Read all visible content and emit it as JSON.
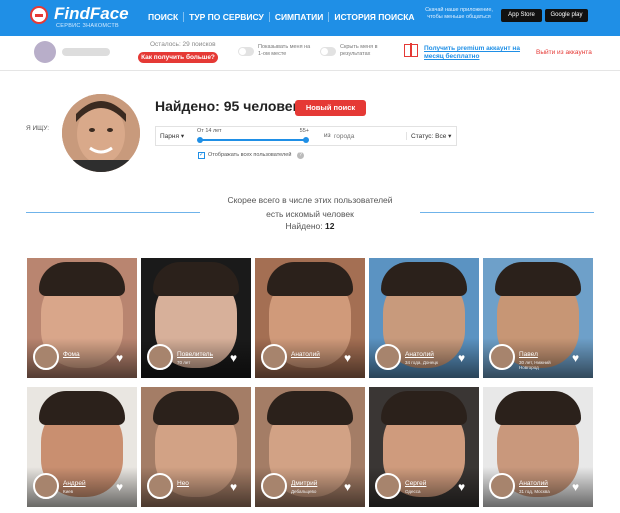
{
  "header": {
    "brand": "FindFace",
    "tagline": "СЕРВИС ЗНАКОМСТВ",
    "nav": [
      "ПОИСК",
      "ТУР ПО СЕРВИСУ",
      "СИМПАТИИ",
      "ИСТОРИЯ ПОИСКА"
    ],
    "apps_note": "Скачай наше приложение, чтобы меньше общаться",
    "appstore_label": "App Store",
    "gplay_label": "Google play"
  },
  "subbar": {
    "searches_left": "Осталось: 29 поисков",
    "more_button": "Как получить больше?",
    "toggle1_label": "Показывать меня на 1-ом месте",
    "toggle2_label": "Скрыть меня в результатах",
    "premium_link": "Получить premium аккаунт на месяц бесплатно",
    "logout_link": "Выйти из аккаунта"
  },
  "search": {
    "iskat_label": "Я ИЩУ:",
    "found_title": "Найдено: 95 человек",
    "new_search_button": "Новый поиск",
    "gender": "Парня ▾",
    "age_min": "От 14 лет",
    "age_max": "55+",
    "city_prefix": "из",
    "city_placeholder": "города",
    "status": "Статус: Все ▾",
    "show_all_label": "Отображать всех пользователей",
    "check_mark": "✓",
    "help_mark": "?"
  },
  "results": {
    "line1": "Скорее всего в числе этих пользователей",
    "line2": "есть искомый человек",
    "found_label": "Найдено:",
    "found_count": "12"
  },
  "cards": [
    {
      "name": "Фома",
      "sub": "",
      "bg": "#b98570",
      "skin": "#d9a68a"
    },
    {
      "name": "Повелитель",
      "sub": "70 лет",
      "bg": "#1a1a1a",
      "skin": "#d7b09a"
    },
    {
      "name": "Анатолий",
      "sub": "",
      "bg": "#a46f53",
      "skin": "#d09a7a"
    },
    {
      "name": "Анатолий",
      "sub": "34 года, Донецк",
      "bg": "#5b93c2",
      "skin": "#c89a7c"
    },
    {
      "name": "Павел",
      "sub": "30 лет, Нижний Новгород",
      "bg": "#6ea0c9",
      "skin": "#c79675"
    },
    {
      "name": "Андрей",
      "sub": "Киев",
      "bg": "#e9e6e1",
      "skin": "#c98f70"
    },
    {
      "name": "Нео",
      "sub": "",
      "bg": "#a47d66",
      "skin": "#d2a285"
    },
    {
      "name": "Дмитрий",
      "sub": "Дебальцево",
      "bg": "#a47d66",
      "skin": "#d2a285"
    },
    {
      "name": "Сергей",
      "sub": "Одесса",
      "bg": "#3a3634",
      "skin": "#cf9b7d"
    },
    {
      "name": "Анатолий",
      "sub": "31 год, Москва",
      "bg": "#e8e8e8",
      "skin": "#c9987c"
    }
  ],
  "icons": {
    "heart": "♥",
    "heart_name": "heart-icon"
  },
  "colors": {
    "brand_blue": "#1f8fe6",
    "accent_red": "#e53935"
  }
}
